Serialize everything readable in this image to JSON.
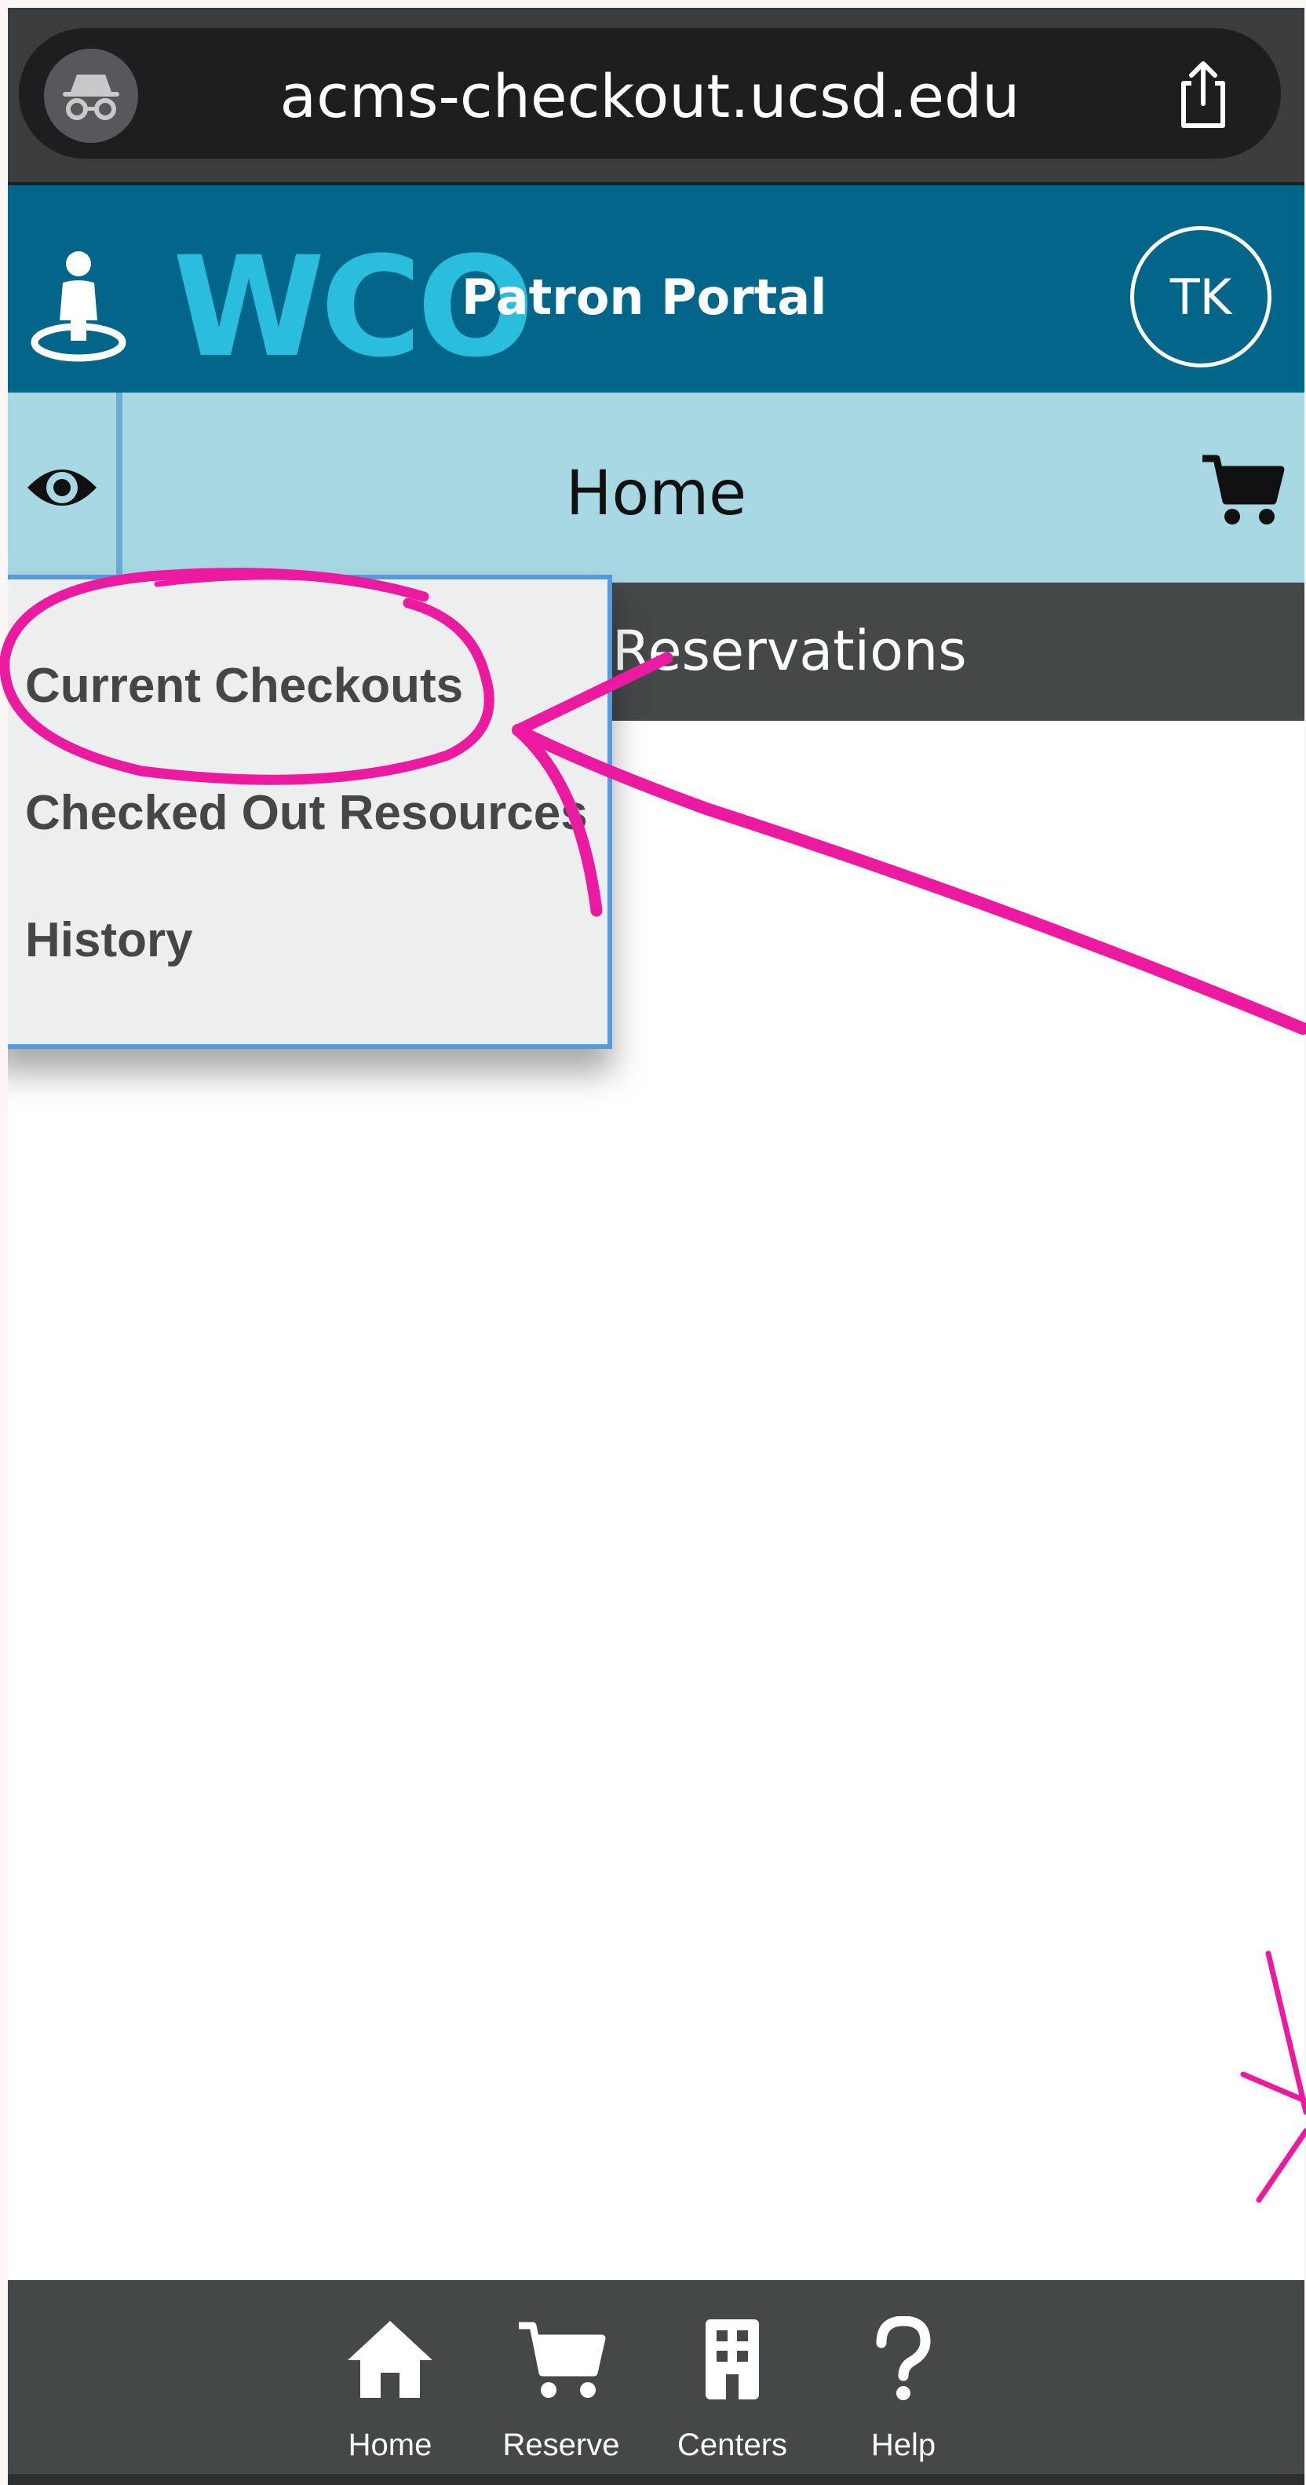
{
  "browser": {
    "url": "acms-checkout.ucsd.edu"
  },
  "header": {
    "brand": "WCO",
    "title": "Patron Portal",
    "avatar_initials": "TK"
  },
  "subheader": {
    "page_title": "Home"
  },
  "nav": {
    "reservations_label": "Reservations"
  },
  "dropdown": {
    "items": [
      {
        "label": "Current Checkouts"
      },
      {
        "label": "Checked Out Resources"
      },
      {
        "label": "History"
      }
    ]
  },
  "bottom_nav": {
    "items": [
      {
        "label": "Home",
        "icon": "home-icon"
      },
      {
        "label": "Reserve",
        "icon": "cart-icon"
      },
      {
        "label": "Centers",
        "icon": "building-icon"
      },
      {
        "label": "Help",
        "icon": "question-icon"
      }
    ]
  },
  "colors": {
    "header_bg": "#02668a",
    "brand_accent": "#29bdde",
    "subheader_bg": "#a8d8e4",
    "nav_bg": "#444849",
    "annotation": "#ec1aa0"
  }
}
